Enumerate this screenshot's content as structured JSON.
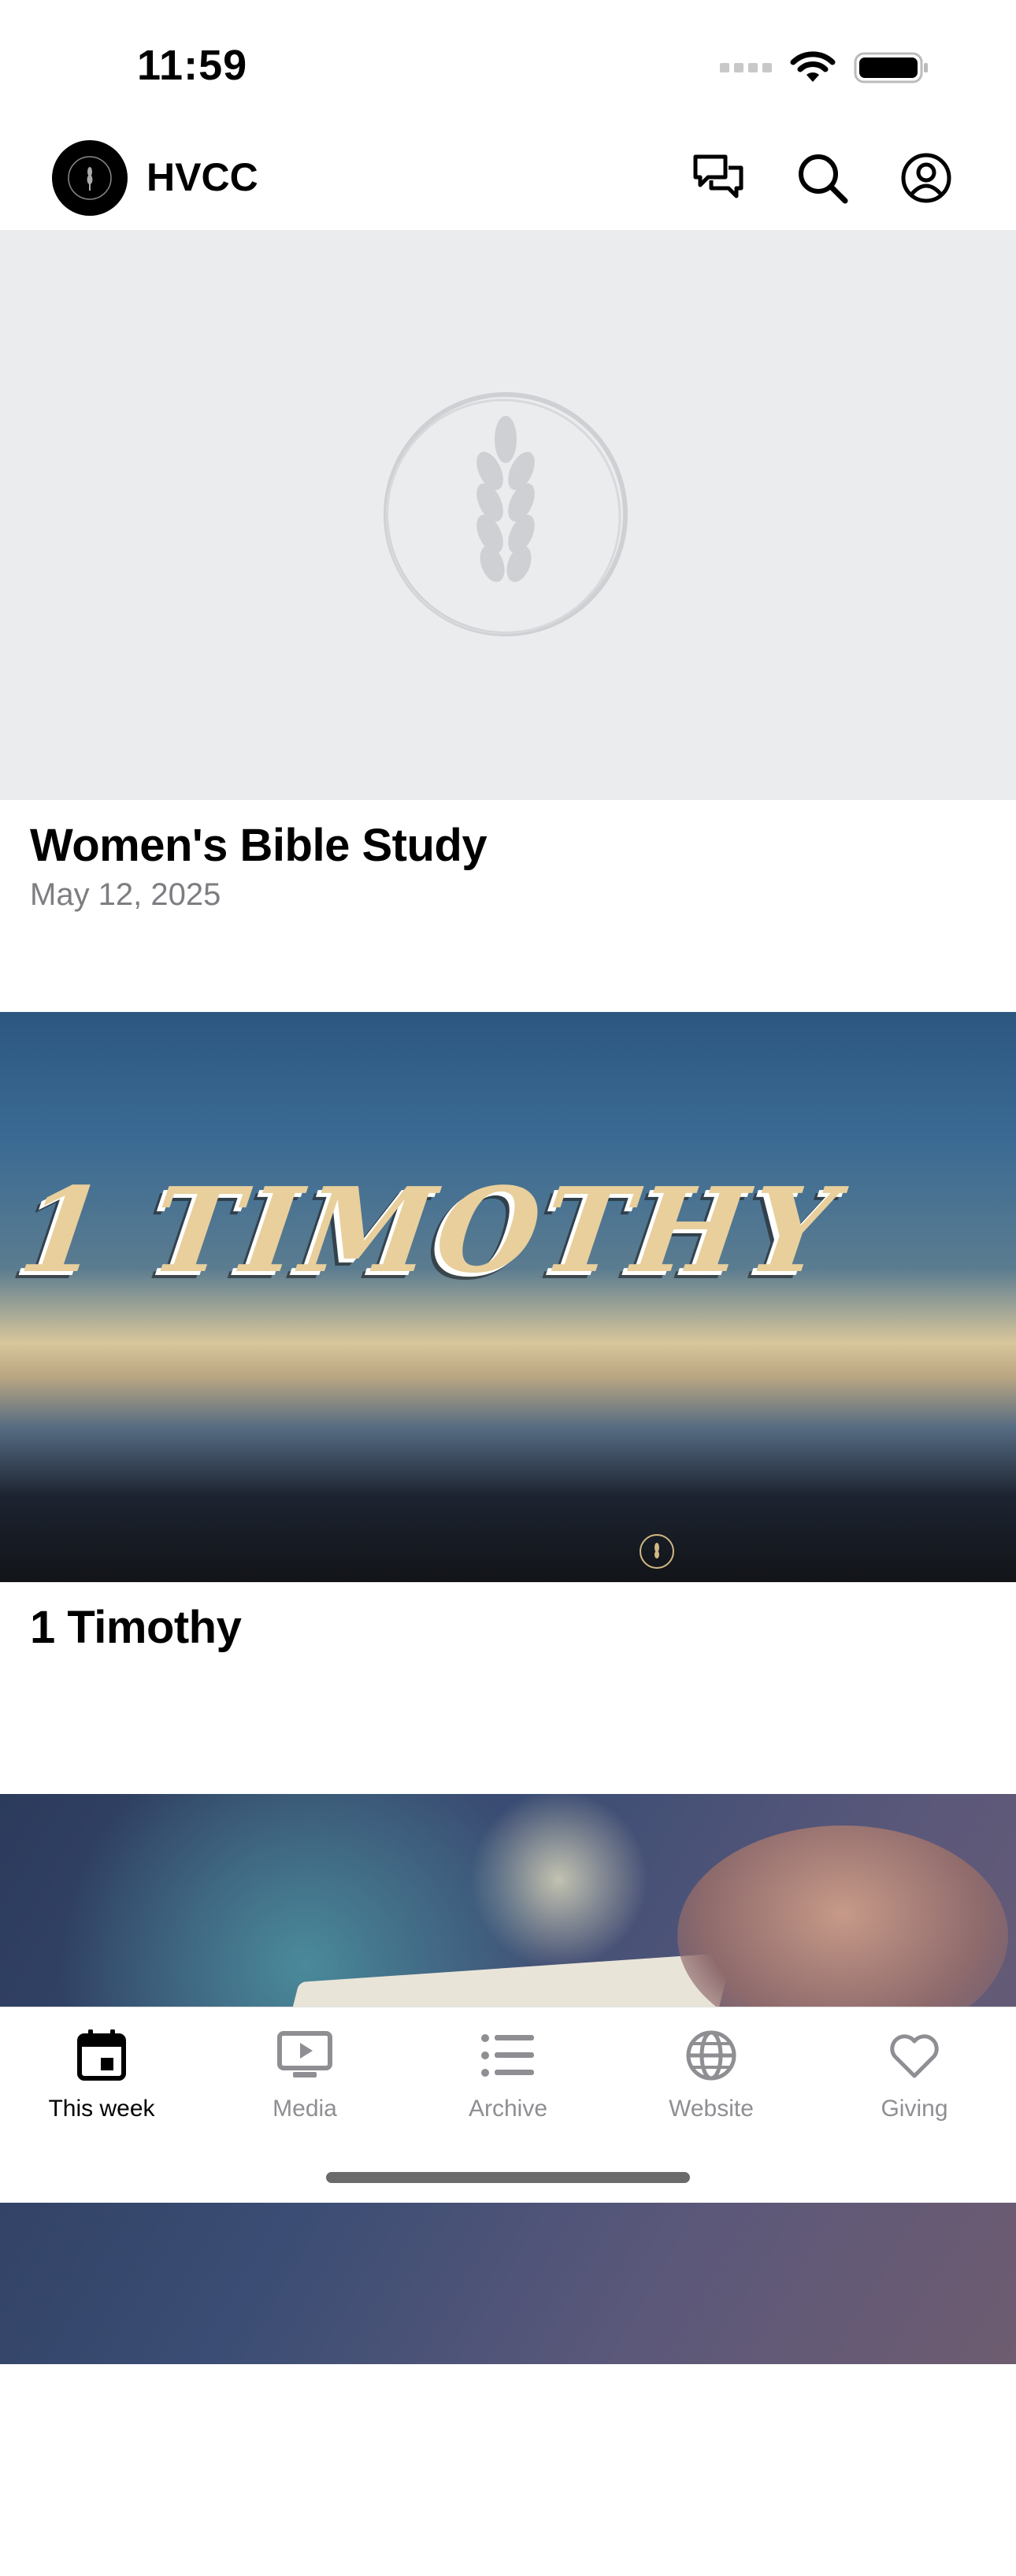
{
  "status_bar": {
    "time": "11:59"
  },
  "header": {
    "title": "HVCC",
    "icons": [
      "chat-icon",
      "search-icon",
      "profile-icon"
    ]
  },
  "feed": [
    {
      "title": "Women's Bible Study",
      "date": "May 12, 2025",
      "image": "wheat-logo-placeholder"
    },
    {
      "title": "1 Timothy",
      "date": "",
      "image_text": "1 TIMOTHY"
    },
    {
      "title": "",
      "date": "",
      "image": "open-bible-photo"
    }
  ],
  "tabs": [
    {
      "label": "This week",
      "icon": "calendar-icon",
      "active": true
    },
    {
      "label": "Media",
      "icon": "play-screen-icon"
    },
    {
      "label": "Archive",
      "icon": "list-icon"
    },
    {
      "label": "Website",
      "icon": "globe-icon"
    },
    {
      "label": "Giving",
      "icon": "heart-icon"
    }
  ],
  "colors": {
    "accent": "#000000",
    "inactive": "#8e8e93",
    "placeholder_bg": "#ebecee",
    "timothy_text": "#e8cf9c"
  }
}
